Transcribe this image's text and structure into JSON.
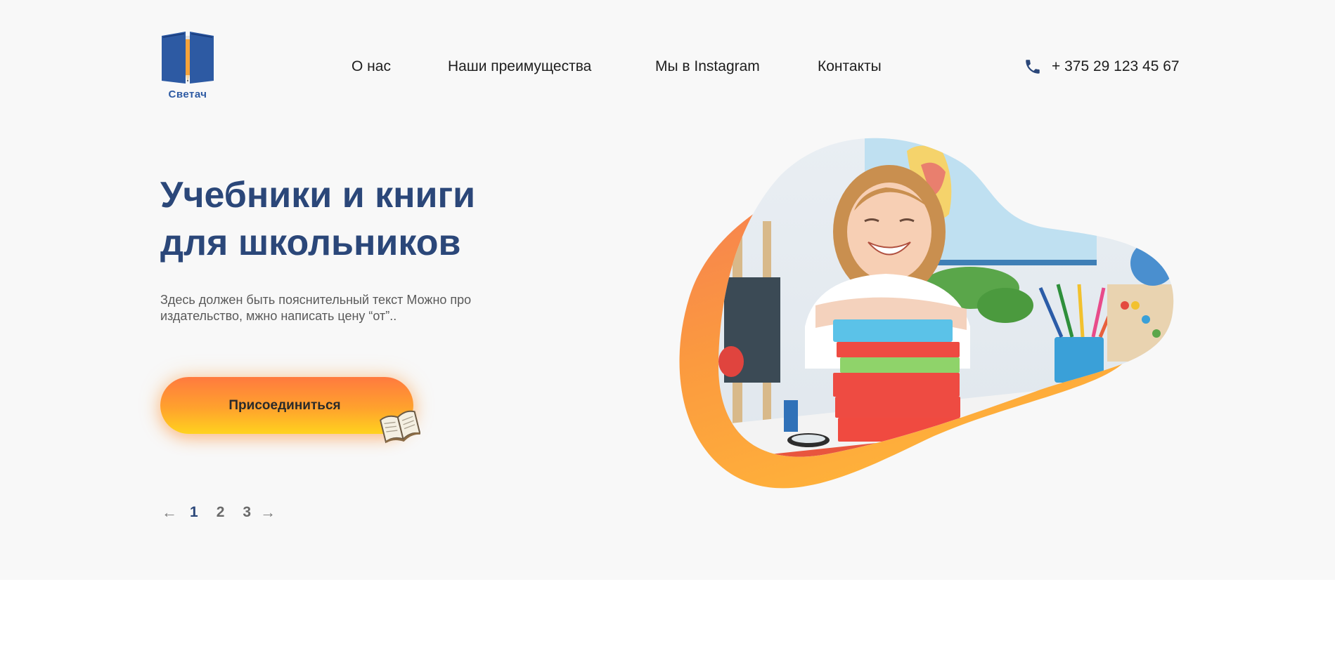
{
  "brand": {
    "name": "Светач"
  },
  "nav": {
    "items": [
      {
        "label": "О нас"
      },
      {
        "label": "Наши преимущества"
      },
      {
        "label": "Мы в Instagram"
      },
      {
        "label": "Контакты"
      }
    ]
  },
  "contact": {
    "phone": "+ 375 29 123 45 67",
    "icon": "phone-icon"
  },
  "hero": {
    "title_line1": "Учебники и книги",
    "title_line2": "для школьников",
    "description": "Здесь должен быть пояснительный текст Можно про издательство, мжно написать цену “от”..",
    "cta_label": "Присоединиться"
  },
  "pagination": {
    "prev": "←",
    "next": "→",
    "pages": [
      "1",
      "2",
      "3"
    ],
    "active_page": "1"
  },
  "colors": {
    "accent_blue": "#2b4779",
    "logo_blue": "#2d5aa3",
    "accent_orange": "#ff8a3a",
    "accent_yellow": "#ffd21e",
    "background": "#f8f8f8"
  }
}
